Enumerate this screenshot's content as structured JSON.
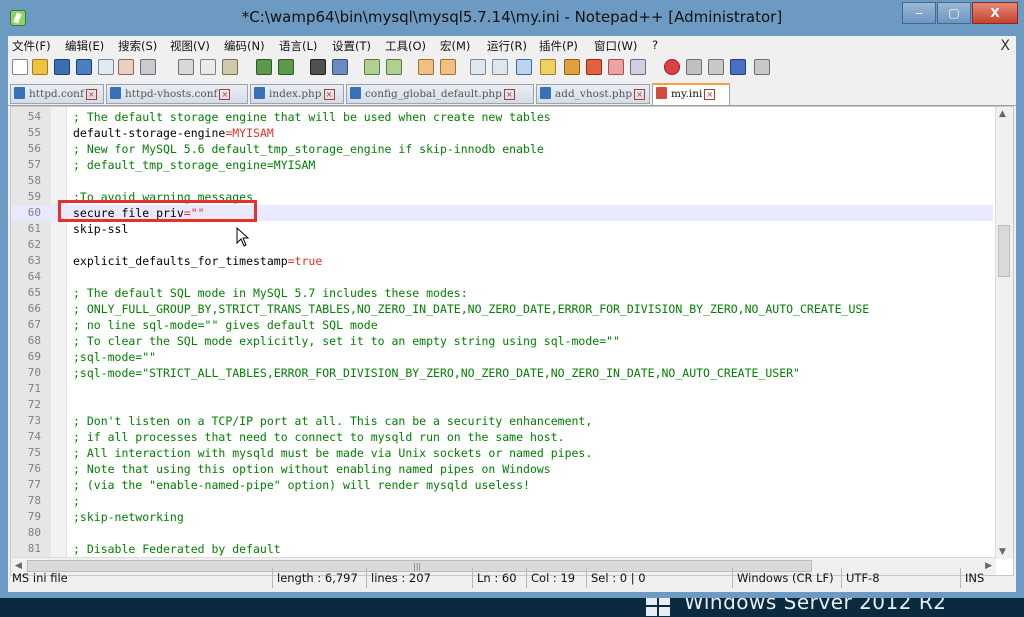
{
  "window": {
    "title": "*C:\\wamp64\\bin\\mysql\\mysql5.7.14\\my.ini - Notepad++ [Administrator]",
    "min_label": "‒",
    "max_label": "▢",
    "close_label": "X"
  },
  "menu": {
    "items": [
      "文件(F)",
      "编辑(E)",
      "搜索(S)",
      "视图(V)",
      "编码(N)",
      "语言(L)",
      "设置(T)",
      "工具(O)",
      "宏(M)",
      "运行(R)",
      "插件(P)",
      "窗口(W)",
      "?"
    ],
    "close_label": "X"
  },
  "tabs": [
    {
      "label": "httpd.conf",
      "active": false
    },
    {
      "label": "httpd-vhosts.conf",
      "active": false
    },
    {
      "label": "index.php",
      "active": false
    },
    {
      "label": "config_global_default.php",
      "active": false
    },
    {
      "label": "add_vhost.php",
      "active": false
    },
    {
      "label": "my.ini",
      "active": true
    }
  ],
  "editor": {
    "current_line": 60,
    "lines": [
      {
        "n": "54",
        "text": "; The default storage engine that will be used when create new tables",
        "comment": true
      },
      {
        "n": "55",
        "text": "default-storage-engine=MYISAM",
        "comment": false
      },
      {
        "n": "56",
        "text": "; New for MySQL 5.6 default_tmp_storage_engine if skip-innodb enable",
        "comment": true
      },
      {
        "n": "57",
        "text": "; default_tmp_storage_engine=MYISAM",
        "comment": true
      },
      {
        "n": "58",
        "text": "",
        "comment": false
      },
      {
        "n": "59",
        "text": ";To avoid warning messages",
        "comment": true
      },
      {
        "n": "60",
        "text": "secure_file_priv=\"\"",
        "comment": false
      },
      {
        "n": "61",
        "text": "skip-ssl",
        "comment": false
      },
      {
        "n": "62",
        "text": "",
        "comment": false
      },
      {
        "n": "63",
        "text": "explicit_defaults_for_timestamp=true",
        "comment": false
      },
      {
        "n": "64",
        "text": "",
        "comment": false
      },
      {
        "n": "65",
        "text": "; The default SQL mode in MySQL 5.7 includes these modes:",
        "comment": true
      },
      {
        "n": "66",
        "text": "; ONLY_FULL_GROUP_BY,STRICT_TRANS_TABLES,NO_ZERO_IN_DATE,NO_ZERO_DATE,ERROR_FOR_DIVISION_BY_ZERO,NO_AUTO_CREATE_USE",
        "comment": true
      },
      {
        "n": "67",
        "text": "; no line sql-mode=\"\" gives default SQL mode",
        "comment": true
      },
      {
        "n": "68",
        "text": "; To clear the SQL mode explicitly, set it to an empty string using sql-mode=\"\"",
        "comment": true
      },
      {
        "n": "69",
        "text": ";sql-mode=\"\"",
        "comment": true
      },
      {
        "n": "70",
        "text": ";sql-mode=\"STRICT_ALL_TABLES,ERROR_FOR_DIVISION_BY_ZERO,NO_ZERO_DATE,NO_ZERO_IN_DATE,NO_AUTO_CREATE_USER\"",
        "comment": true
      },
      {
        "n": "71",
        "text": "",
        "comment": false
      },
      {
        "n": "72",
        "text": "",
        "comment": false
      },
      {
        "n": "73",
        "text": "; Don't listen on a TCP/IP port at all. This can be a security enhancement,",
        "comment": true
      },
      {
        "n": "74",
        "text": "; if all processes that need to connect to mysqld run on the same host.",
        "comment": true
      },
      {
        "n": "75",
        "text": "; All interaction with mysqld must be made via Unix sockets or named pipes.",
        "comment": true
      },
      {
        "n": "76",
        "text": "; Note that using this option without enabling named pipes on Windows",
        "comment": true
      },
      {
        "n": "77",
        "text": "; (via the \"enable-named-pipe\" option) will render mysqld useless!",
        "comment": true
      },
      {
        "n": "78",
        "text": ";",
        "comment": true
      },
      {
        "n": "79",
        "text": ";skip-networking",
        "comment": true
      },
      {
        "n": "80",
        "text": "",
        "comment": false
      },
      {
        "n": "81",
        "text": "; Disable Federated by default",
        "comment": true
      }
    ]
  },
  "status": {
    "file_type": "MS ini file",
    "length": "length : 6,797",
    "lines": "lines : 207",
    "ln": "Ln : 60",
    "col": "Col : 19",
    "sel": "Sel : 0 | 0",
    "eol": "Windows (CR LF)",
    "encoding": "UTF-8",
    "mode": "INS"
  },
  "desktop": {
    "os_label": "Windows Server 2012 R2"
  },
  "colors": {
    "comment": "#008000",
    "operator": "#e8302a",
    "current_line": "#e8e8ff",
    "highlight_box": "#e8302a",
    "active_tab_accent": "#f3a33b"
  }
}
